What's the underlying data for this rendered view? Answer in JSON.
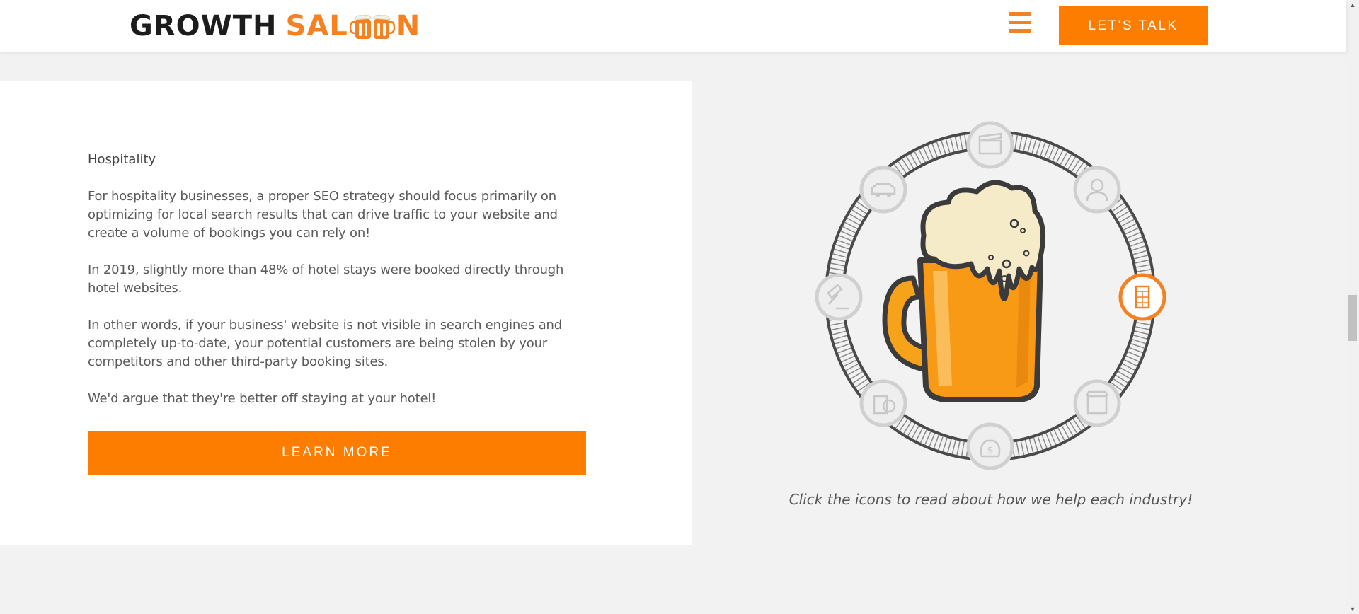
{
  "header": {
    "logo_part1": "GROWTH",
    "logo_part2_start": "SAL",
    "logo_part2_end": "N",
    "cta_label": "LET'S TALK",
    "menu_icon": "hamburger-menu-icon"
  },
  "content": {
    "title": "Hospitality",
    "paragraphs": [
      "For hospitality businesses, a proper SEO strategy should focus primarily on optimizing for local search results that can drive traffic to your website and create a volume of bookings you can rely on!",
      "In 2019, slightly more than 48% of hotel stays were booked directly through hotel websites.",
      "In other words, if your business' website is not visible in search engines and completely up-to-date, your potential customers are being stolen by your competitors and other third-party booking sites.",
      "We'd argue that they're better off staying at your hotel!"
    ],
    "button_label": "LEARN MORE"
  },
  "wheel": {
    "center_icon": "beer-mug-icon",
    "industries": [
      {
        "icon": "film-clapperboard-icon",
        "active": false
      },
      {
        "icon": "doctor-icon",
        "active": false
      },
      {
        "icon": "hotel-icon",
        "label": "HOTEL",
        "active": true
      },
      {
        "icon": "storefront-icon",
        "active": false
      },
      {
        "icon": "money-bag-icon",
        "active": false
      },
      {
        "icon": "restaurant-icon",
        "active": false
      },
      {
        "icon": "gavel-icon",
        "active": false
      },
      {
        "icon": "car-icon",
        "active": false
      }
    ],
    "caption": "Click the icons to read about how we help each industry!"
  },
  "colors": {
    "accent": "#fc7d00",
    "logo_orange": "#f68121",
    "background": "#f2f2f2",
    "panel": "#ffffff"
  }
}
